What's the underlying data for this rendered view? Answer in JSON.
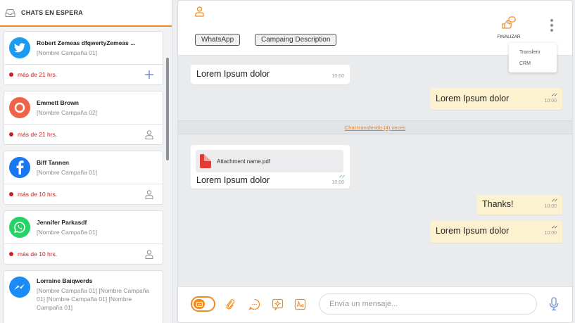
{
  "queue": {
    "title": "CHATS EN ESPERA",
    "items": [
      {
        "name": "Robert Zemeas dfqwertyZemeas ...",
        "campaign": "[Nombre Campaña 01]",
        "time": "más de 21 hrs.",
        "channel": "twitter",
        "action": "plus-icon"
      },
      {
        "name": "Emmett Brown",
        "campaign": "[Nombre Campaña 02]",
        "time": "más de 21 hrs.",
        "channel": "chat",
        "action": "user-icon"
      },
      {
        "name": "Biff Tannen",
        "campaign": "[Nombre Campaña 01]",
        "time": "más de 10 hrs.",
        "channel": "facebook",
        "action": "user-icon"
      },
      {
        "name": "Jennifer Parkasdf",
        "campaign": "[Nombre Campaña 01]",
        "time": "más de 10 hrs.",
        "channel": "whatsapp",
        "action": "user-icon"
      },
      {
        "name": "Lorraine Baiqwerds",
        "campaign": "[Nombre Campaña 01] [Nombre Campaña 01] [Nombre Campaña 01] [Nombre Campaña 01]",
        "time": "",
        "channel": "messenger",
        "action": ""
      }
    ]
  },
  "chat": {
    "tags": [
      "WhatsApp",
      "Campaing Description"
    ],
    "finalize_label": "FINALIZAR",
    "menu": [
      "Transferir",
      "CRM"
    ],
    "messages": [
      {
        "dir": "in",
        "text": "Lorem Ipsum dolor",
        "time": "10:00"
      },
      {
        "dir": "out",
        "text": "Lorem Ipsum dolor",
        "time": "10:00",
        "status": "read"
      },
      {
        "dir": "in",
        "text": "Lorem Ipsum dolor",
        "time": "10:00",
        "attachment": "Attachment name.pdf",
        "status": "delivered"
      },
      {
        "dir": "out",
        "text": "Thanks!",
        "time": "10:00",
        "status": "read"
      },
      {
        "dir": "out",
        "text": "Lorem Ipsum dolor",
        "time": "10:00",
        "status": "read"
      }
    ],
    "transfer_note": "Chat transferido (4) veces",
    "composer_placeholder": "Envía un mensaje...",
    "accent": "#f08a24"
  }
}
